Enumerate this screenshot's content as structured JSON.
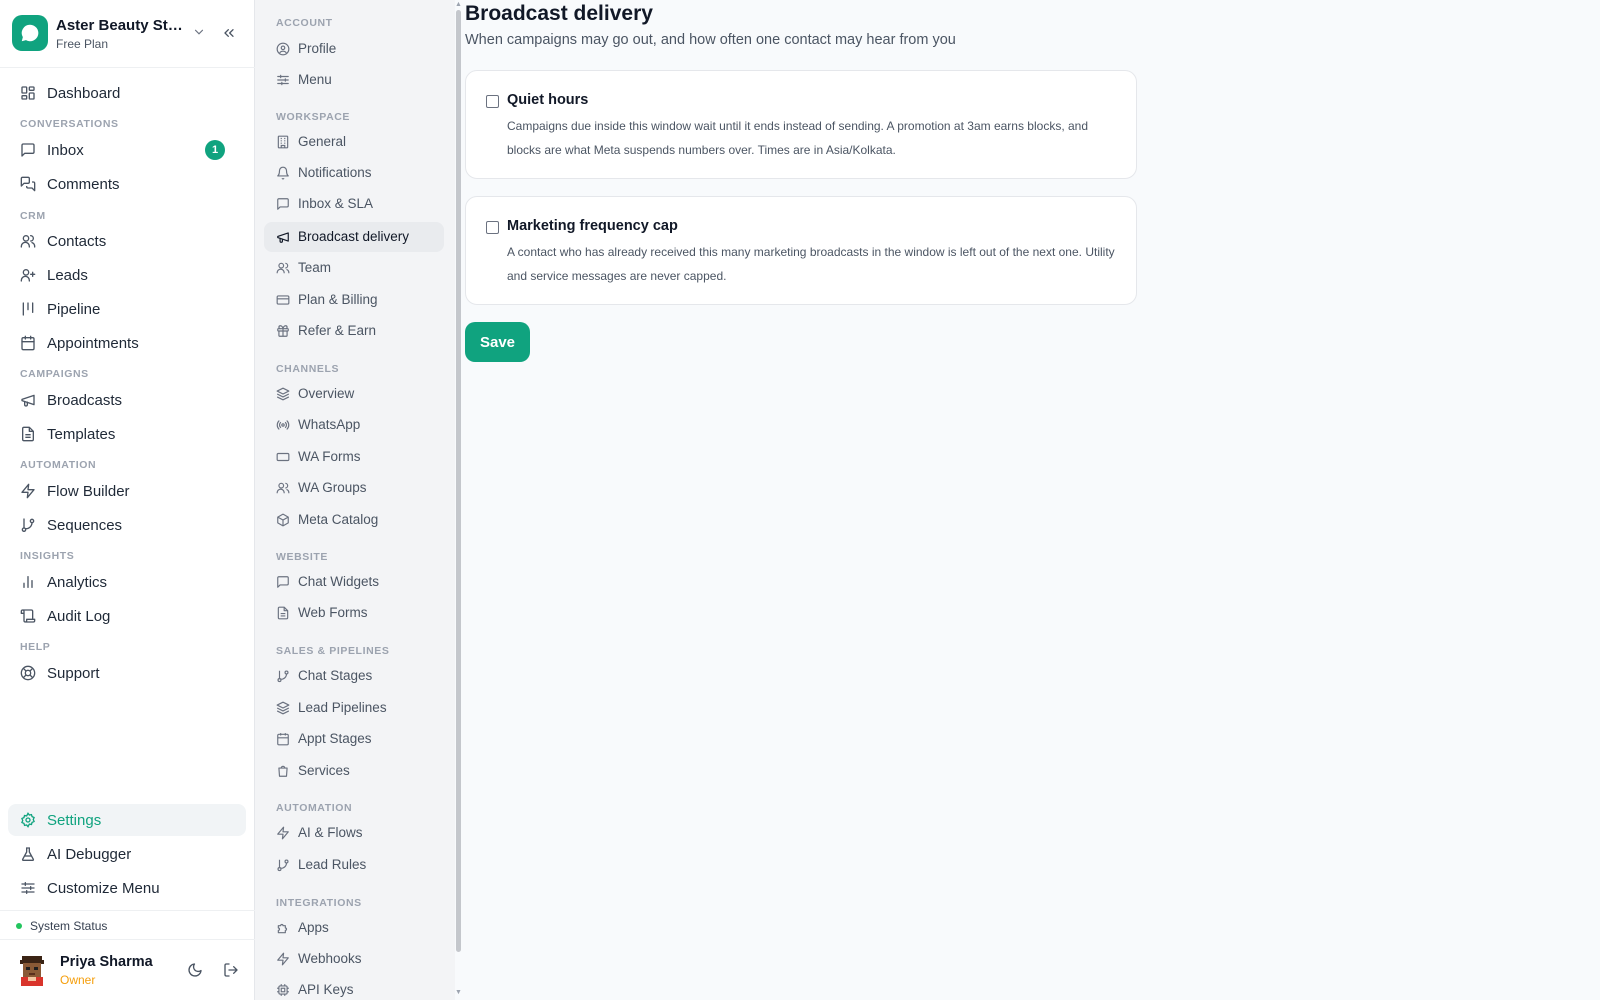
{
  "workspace": {
    "name": "Aster Beauty Studio",
    "plan": "Free Plan"
  },
  "sidebar": {
    "dashboard": "Dashboard",
    "sections": {
      "conversations": "CONVERSATIONS",
      "crm": "CRM",
      "campaigns": "CAMPAIGNS",
      "automation": "AUTOMATION",
      "insights": "INSIGHTS",
      "help": "HELP"
    },
    "items": {
      "inbox": "Inbox",
      "inbox_badge": "1",
      "comments": "Comments",
      "contacts": "Contacts",
      "leads": "Leads",
      "pipeline": "Pipeline",
      "appointments": "Appointments",
      "broadcasts": "Broadcasts",
      "templates": "Templates",
      "flow_builder": "Flow Builder",
      "sequences": "Sequences",
      "analytics": "Analytics",
      "audit_log": "Audit Log",
      "support": "Support",
      "settings": "Settings",
      "ai_debugger": "AI Debugger",
      "customize_menu": "Customize Menu"
    },
    "system_status": "System Status",
    "user": {
      "name": "Priya Sharma",
      "role": "Owner"
    }
  },
  "settings_nav": {
    "sections": {
      "account": "ACCOUNT",
      "workspace": "WORKSPACE",
      "channels": "CHANNELS",
      "website": "WEBSITE",
      "sales_pipelines": "SALES & PIPELINES",
      "automation": "AUTOMATION",
      "integrations": "INTEGRATIONS"
    },
    "items": {
      "profile": "Profile",
      "menu": "Menu",
      "general": "General",
      "notifications": "Notifications",
      "inbox_sla": "Inbox & SLA",
      "broadcast_delivery": "Broadcast delivery",
      "team": "Team",
      "plan_billing": "Plan & Billing",
      "refer_earn": "Refer & Earn",
      "overview": "Overview",
      "whatsapp": "WhatsApp",
      "wa_forms": "WA Forms",
      "wa_groups": "WA Groups",
      "meta_catalog": "Meta Catalog",
      "chat_widgets": "Chat Widgets",
      "web_forms": "Web Forms",
      "chat_stages": "Chat Stages",
      "lead_pipelines": "Lead Pipelines",
      "appt_stages": "Appt Stages",
      "services": "Services",
      "ai_flows": "AI & Flows",
      "lead_rules": "Lead Rules",
      "apps": "Apps",
      "webhooks": "Webhooks",
      "api_keys": "API Keys"
    }
  },
  "main": {
    "title": "Broadcast delivery",
    "subtitle": "When campaigns may go out, and how often one contact may hear from you",
    "quiet_hours": {
      "title": "Quiet hours",
      "checked": false,
      "description": "Campaigns due inside this window wait until it ends instead of sending. A promotion at 3am earns blocks, and blocks are what Meta suspends numbers over. Times are in Asia/Kolkata."
    },
    "frequency_cap": {
      "title": "Marketing frequency cap",
      "checked": false,
      "description": "A contact who has already received this many marketing broadcasts in the window is left out of the next one. Utility and service messages are never capped."
    },
    "save_label": "Save"
  },
  "colors": {
    "accent": "#10a37f",
    "role": "#f59e0b",
    "status_ok": "#22c55e"
  }
}
